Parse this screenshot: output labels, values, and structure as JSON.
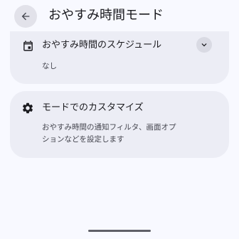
{
  "header": {
    "title": "おやすみ時間モード"
  },
  "schedule_card": {
    "title": "おやすみ時間のスケジュール",
    "value": "なし"
  },
  "customize_card": {
    "title": "モードでのカスタマイズ",
    "description_line1": "おやすみ時間の通知フィルタ、画面オプ",
    "description_line2": "ションなどを設定します"
  },
  "icons": {
    "back": "arrow-left-icon",
    "schedule": "calendar-icon",
    "expand": "chevron-down-icon",
    "customize": "gear-icon"
  }
}
